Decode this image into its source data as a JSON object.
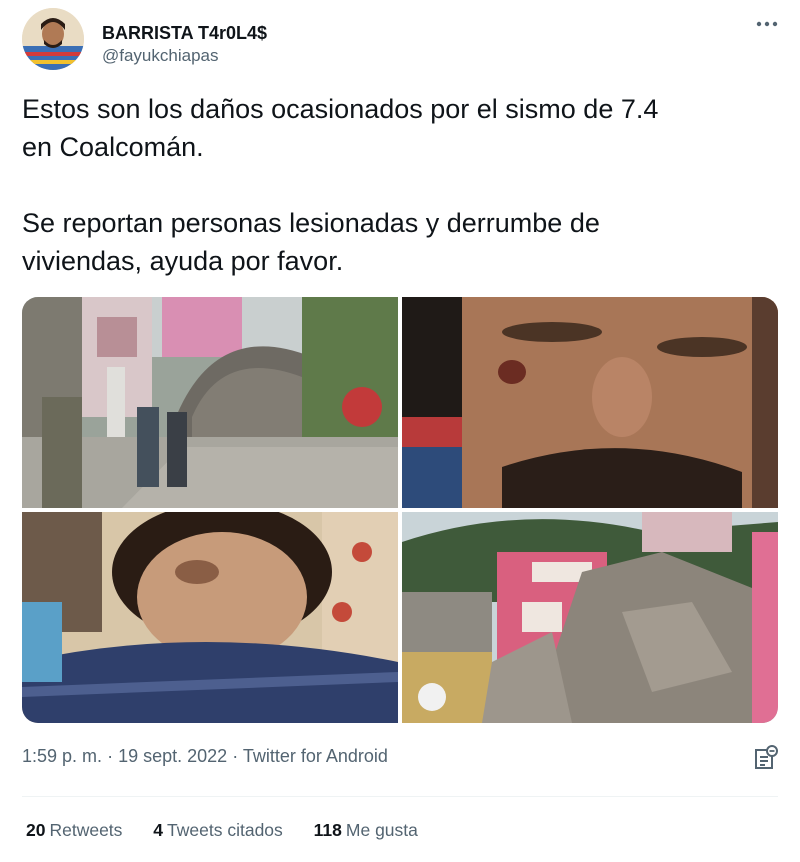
{
  "tweet": {
    "author": {
      "display_name": "BARRISTA T4r0L4$",
      "handle": "@fayukchiapas"
    },
    "text": "Estos son los daños ocasionados por el sismo de 7.4\nen Coalcomán.\n\nSe reportan personas lesionadas y derrumbe de\nviviendas, ayuda por favor.",
    "media": [
      {
        "icon": "photo-street-boulder"
      },
      {
        "icon": "photo-injured-face"
      },
      {
        "icon": "photo-injured-man-lying"
      },
      {
        "icon": "photo-collapsed-houses"
      }
    ],
    "timestamp": "1:59 p. m.",
    "separator": "·",
    "date": "19 sept. 2022",
    "source": "Twitter for Android",
    "stats": {
      "retweets_count": "20",
      "retweets_label": "Retweets",
      "quotes_count": "4",
      "quotes_label": "Tweets citados",
      "likes_count": "118",
      "likes_label": "Me gusta"
    }
  },
  "colors": {
    "text_primary": "#0f1419",
    "text_secondary": "#536471",
    "divider": "#eff3f4"
  },
  "icons": {
    "more": "more-dots-icon",
    "analytics": "analytics-icon"
  }
}
